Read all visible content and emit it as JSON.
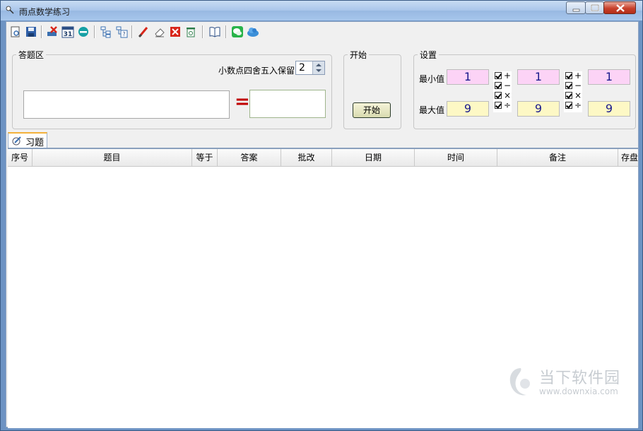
{
  "window": {
    "title": "雨点数学练习"
  },
  "toolbar": {
    "icons": [
      "new-document-icon",
      "save-icon",
      "delete-icon",
      "calendar-icon",
      "stop-icon",
      "tree-icon",
      "help-icon",
      "brush-icon",
      "eraser-icon",
      "close-red-icon",
      "recycle-icon",
      "book-icon",
      "wechat-icon",
      "cloud-icon"
    ]
  },
  "answer_area": {
    "legend": "答题区",
    "round_label": "小数点四舍五入保留",
    "round_value": "2",
    "equals": "="
  },
  "start": {
    "legend": "开始",
    "button": "开始"
  },
  "settings": {
    "legend": "设置",
    "min_label": "最小值",
    "max_label": "最大值",
    "min_a": "1",
    "max_a": "9",
    "min_b": "1",
    "max_b": "9",
    "min_c": "1",
    "max_c": "9",
    "ops": [
      "+",
      "−",
      "×",
      "÷"
    ]
  },
  "tab": {
    "label": "习题"
  },
  "grid": {
    "columns": [
      "序号",
      "题目",
      "等于",
      "答案",
      "批改",
      "日期",
      "时间",
      "备注",
      "存盘"
    ]
  },
  "watermark": {
    "cn": "当下软件园",
    "url": "www.downxia.com"
  },
  "colors": {
    "min_bg": "#fcd3f6",
    "max_bg": "#fdf8c5",
    "equals": "#c00000",
    "tab_accent": "#f3b13a"
  }
}
